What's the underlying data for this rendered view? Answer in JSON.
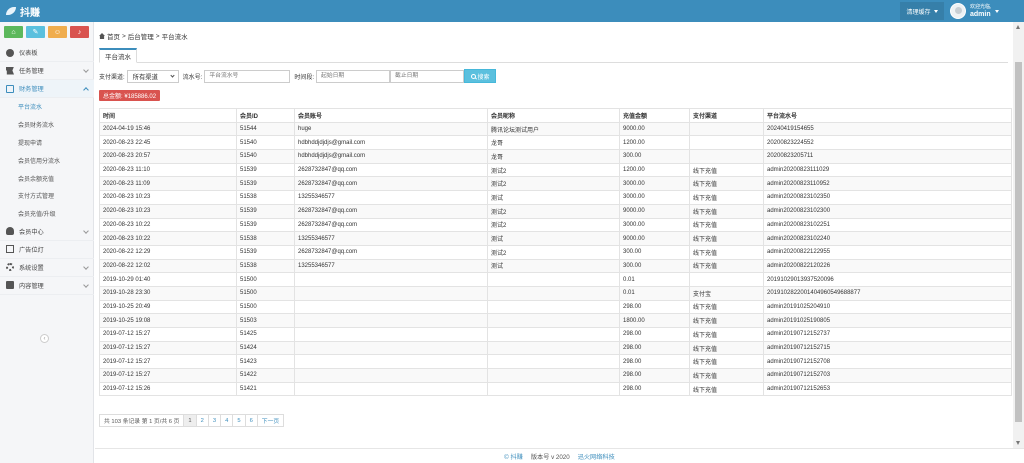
{
  "app": {
    "logo_text": "抖赚"
  },
  "header": {
    "clear_cache": "清理缓存",
    "welcome": "欢迎光临,",
    "username": "admin"
  },
  "sidebar": {
    "items": [
      {
        "label": "仪表板",
        "icon": "dashboard-icon"
      },
      {
        "label": "任务管理",
        "icon": "flag-icon"
      },
      {
        "label": "财务管理",
        "icon": "wallet-icon"
      },
      {
        "label": "会员中心",
        "icon": "user-icon"
      },
      {
        "label": "广告位灯",
        "icon": "image-icon"
      },
      {
        "label": "系统设置",
        "icon": "gear-icon"
      },
      {
        "label": "内容管理",
        "icon": "book-icon"
      }
    ],
    "finance_sub": [
      "平台流水",
      "会员财务流水",
      "提现申请",
      "会员信用分流水",
      "会员余额充值",
      "支付方式管理",
      "会员充值/升级"
    ]
  },
  "breadcrumb": {
    "home": "首页",
    "sep": ">",
    "level1": "后台管理",
    "level2": "平台流水"
  },
  "tab": {
    "label": "平台流水"
  },
  "filters": {
    "channel_label": "支付渠道:",
    "channel_value": "所有渠道",
    "serial_label": "流水号:",
    "serial_placeholder": "平台流水号",
    "time_label": "时间段:",
    "start_placeholder": "起始日期",
    "end_placeholder": "截止日期",
    "search_label": "搜索"
  },
  "total": {
    "label": "总金额: ¥185886.02"
  },
  "table": {
    "columns": [
      "时间",
      "会员ID",
      "会员账号",
      "会员昵称",
      "充值金额",
      "支付渠道",
      "平台流水号"
    ],
    "rows": [
      [
        "2024-04-19 15:46",
        "51544",
        "huge",
        "腾讯论坛测试用户",
        "9000.00",
        "",
        "20240419154655"
      ],
      [
        "2020-08-23 22:45",
        "51540",
        "hdbhddjdjdjs@gmail.com",
        "龙哥",
        "1200.00",
        "",
        "20200823224552"
      ],
      [
        "2020-08-23 20:57",
        "51540",
        "hdbhddjdjdjs@gmail.com",
        "龙哥",
        "300.00",
        "",
        "20200823205711"
      ],
      [
        "2020-08-23 11:10",
        "51539",
        "2628732847@qq.com",
        "测试2",
        "1200.00",
        "线下充值",
        "admin20200823111029"
      ],
      [
        "2020-08-23 11:09",
        "51539",
        "2628732847@qq.com",
        "测试2",
        "3000.00",
        "线下充值",
        "admin20200823110952"
      ],
      [
        "2020-08-23 10:23",
        "51538",
        "13255346577",
        "测试",
        "3000.00",
        "线下充值",
        "admin20200823102350"
      ],
      [
        "2020-08-23 10:23",
        "51539",
        "2628732847@qq.com",
        "测试2",
        "9000.00",
        "线下充值",
        "admin20200823102300"
      ],
      [
        "2020-08-23 10:22",
        "51539",
        "2628732847@qq.com",
        "测试2",
        "3000.00",
        "线下充值",
        "admin20200823102251"
      ],
      [
        "2020-08-23 10:22",
        "51538",
        "13255346577",
        "测试",
        "9000.00",
        "线下充值",
        "admin20200823102240"
      ],
      [
        "2020-08-22 12:29",
        "51539",
        "2628732847@qq.com",
        "测试2",
        "300.00",
        "线下充值",
        "admin20200822122955"
      ],
      [
        "2020-08-22 12:02",
        "51538",
        "13255346577",
        "测试",
        "300.00",
        "线下充值",
        "admin20200822120226"
      ],
      [
        "2019-10-29 01:40",
        "51500",
        "",
        "",
        "0.01",
        "",
        "20191029013937520096"
      ],
      [
        "2019-10-28 23:30",
        "51500",
        "",
        "",
        "0.01",
        "支付宝",
        "2019102822001404960549688877"
      ],
      [
        "2019-10-25 20:49",
        "51500",
        "",
        "",
        "298.00",
        "线下充值",
        "admin20191025204910"
      ],
      [
        "2019-10-25 19:08",
        "51503",
        "",
        "",
        "1800.00",
        "线下充值",
        "admin20191025190805"
      ],
      [
        "2019-07-12 15:27",
        "51425",
        "",
        "",
        "298.00",
        "线下充值",
        "admin20190712152737"
      ],
      [
        "2019-07-12 15:27",
        "51424",
        "",
        "",
        "298.00",
        "线下充值",
        "admin20190712152715"
      ],
      [
        "2019-07-12 15:27",
        "51423",
        "",
        "",
        "298.00",
        "线下充值",
        "admin20190712152708"
      ],
      [
        "2019-07-12 15:27",
        "51422",
        "",
        "",
        "298.00",
        "线下充值",
        "admin20190712152703"
      ],
      [
        "2019-07-12 15:26",
        "51421",
        "",
        "",
        "298.00",
        "线下充值",
        "admin20190712152653"
      ]
    ]
  },
  "pagination": {
    "info": "共 103 条记录 第 1 页/共 6 页",
    "pages": [
      "1",
      "2",
      "3",
      "4",
      "5",
      "6"
    ],
    "next": "下一页"
  },
  "footer": {
    "brand": "© 抖赚",
    "version": "版本号 v 2020",
    "company": "迅火网络科技"
  },
  "colors": {
    "header": "#3c8dbc",
    "accent_btn": "#5bc0de",
    "badge": "#d9534f"
  }
}
